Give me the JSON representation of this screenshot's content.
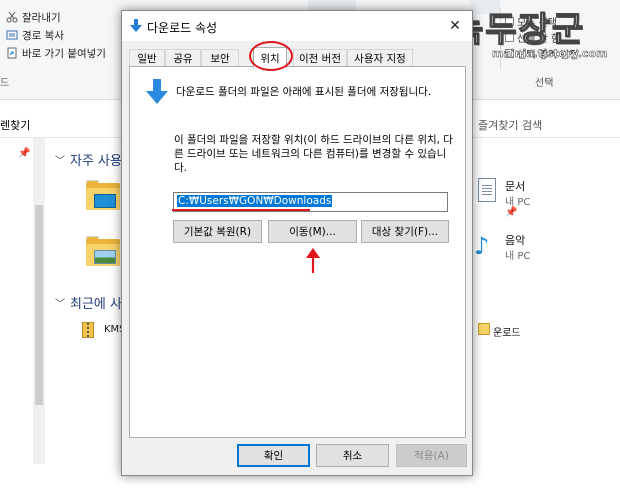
{
  "ribbon": {
    "cut": "잘라내기",
    "copy_path": "경로 복사",
    "paste_shortcut": "바로 가기 붙여넣기",
    "group_left_suffix": "드",
    "right_items": [
      "모두 선택",
      "선택 안 함",
      "선택 영역 반전"
    ],
    "group_right": "선택"
  },
  "address": {
    "path_fragment": "렌찾기",
    "search_placeholder": "즐겨찾기 검색"
  },
  "quick_access": {
    "header": "자주 사용",
    "recent_header": "최근에 사",
    "items": [
      {
        "name": "문서",
        "sub": "내 PC"
      },
      {
        "name": "음악",
        "sub": "내 PC"
      }
    ],
    "recent_file": "KMS",
    "recent_download": "운로드"
  },
  "watermark": {
    "text": "녹두장군",
    "url": "mainia.tistory.com"
  },
  "dialog": {
    "title": "다운로드 속성",
    "tabs": [
      "일반",
      "공유",
      "보안",
      "위치",
      "이전 버전",
      "사용자 지정"
    ],
    "active_tab": "위치",
    "desc1": "다운로드 폴더의 파일은 아래에 표시된 폴더에 저장됩니다.",
    "desc2": "이 폴더의 파일을 저장할 위치(이 하드 드라이브의 다른 위치, 다른 드라이브 또는 네트워크의 다른 컴퓨터)를 변경할 수 있습니다.",
    "path_value": "C:₩Users₩GON₩Downloads",
    "buttons": {
      "restore_default": "기본값 복원(R)",
      "move": "이동(M)...",
      "find_target": "대상 찾기(F)..."
    },
    "footer": {
      "ok": "확인",
      "cancel": "취소",
      "apply": "적용(A)"
    }
  },
  "colors": {
    "accent": "#0078d7",
    "annotation_red": "#e0161b",
    "folder_yellow": "#f8d36a"
  }
}
